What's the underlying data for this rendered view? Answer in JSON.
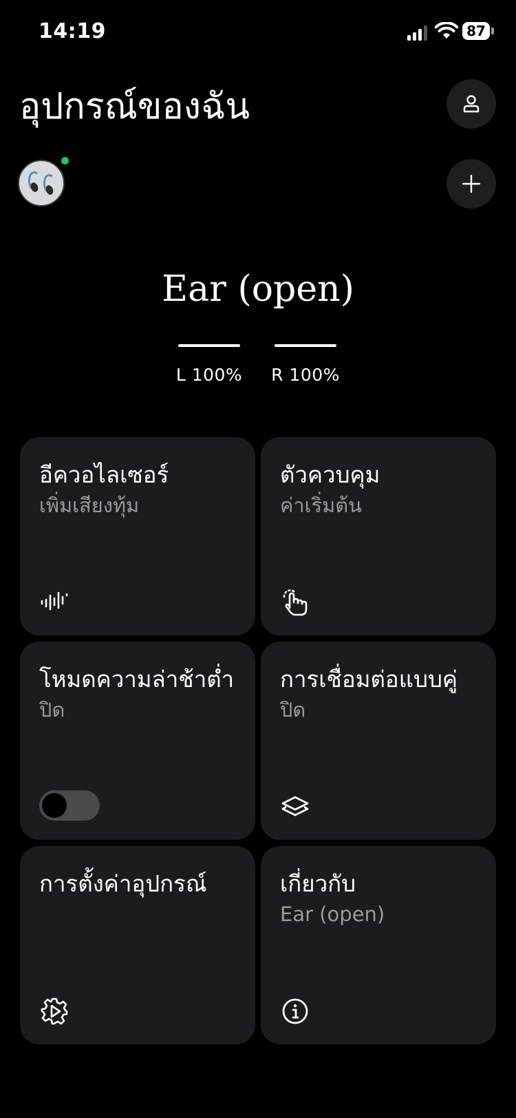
{
  "status_bar": {
    "time": "14:19",
    "battery": "87"
  },
  "header": {
    "title": "อุปกรณ์ของฉัน"
  },
  "device": {
    "name": "Ear (open)",
    "battery_left": "L 100%",
    "battery_right": "R 100%",
    "battery_left_level": 1.0,
    "battery_right_level": 1.0
  },
  "cards": {
    "equalizer": {
      "title": "อีควอไลเซอร์",
      "subtitle": "เพิ่มเสียงทุ้ม",
      "icon": "equalizer-icon"
    },
    "controls": {
      "title": "ตัวควบคุม",
      "subtitle": "ค่าเริ่มต้น",
      "icon": "gesture-touch-icon"
    },
    "low_latency": {
      "title": "โหมดความล่าช้าต่ำ",
      "subtitle": "ปิด",
      "toggle_on": false
    },
    "dual_connection": {
      "title": "การเชื่อมต่อแบบคู่",
      "subtitle": "ปิด",
      "icon": "layers-icon"
    },
    "device_settings": {
      "title": "การตั้งค่าอุปกรณ์",
      "icon": "settings-gear-icon"
    },
    "about": {
      "title": "เกี่ยวกับ",
      "subtitle": "Ear (open)",
      "icon": "info-icon"
    }
  },
  "colors": {
    "background": "#000000",
    "card": "#1c1c1e",
    "online": "#22c55e"
  }
}
